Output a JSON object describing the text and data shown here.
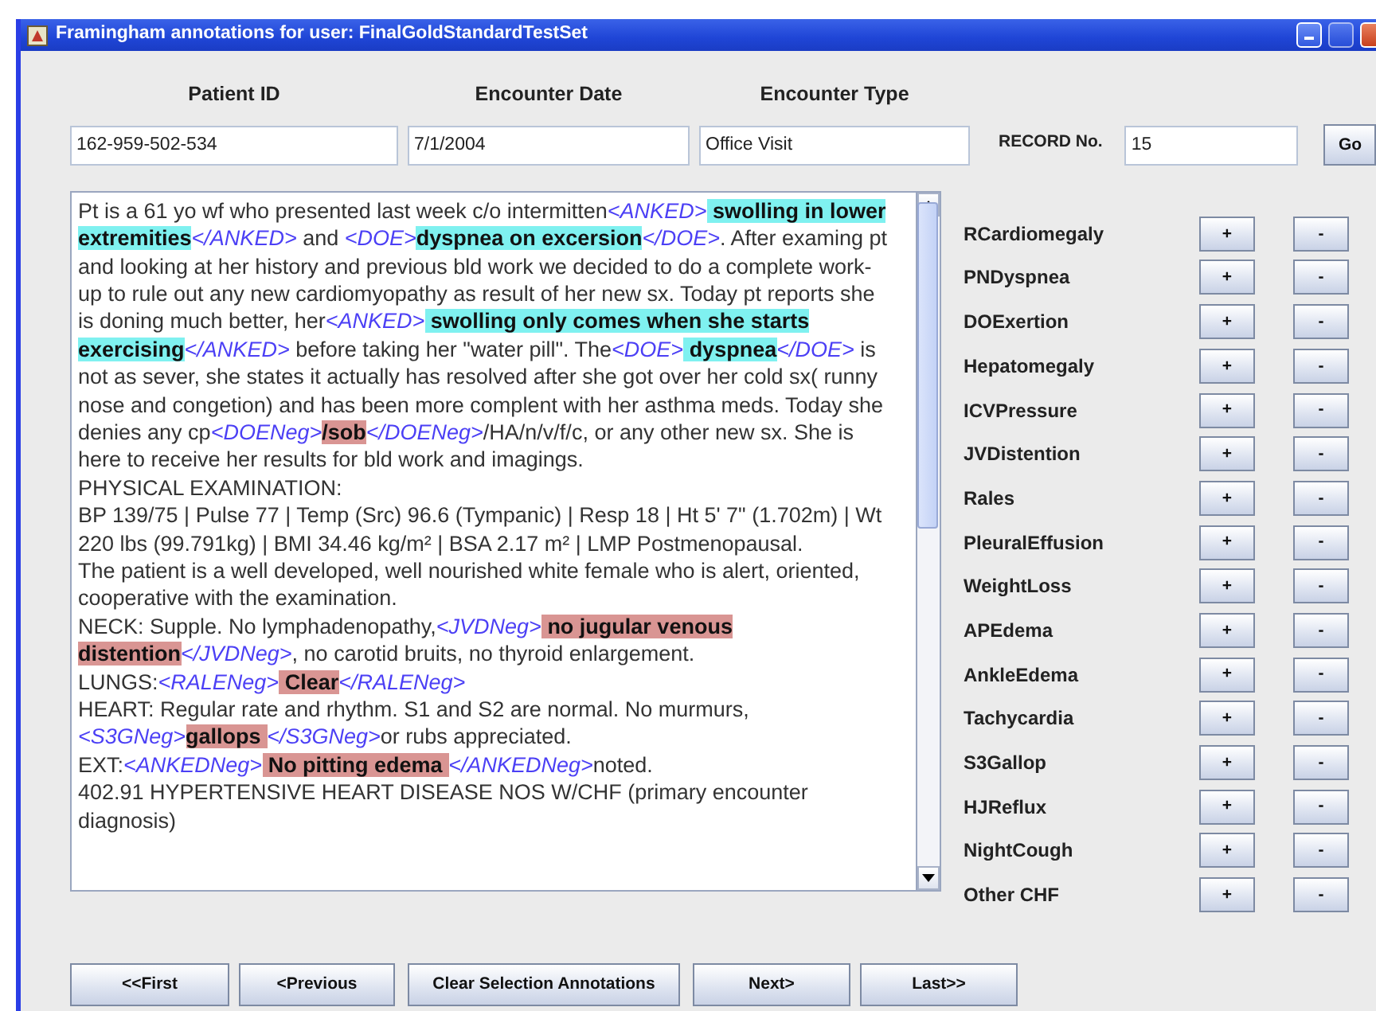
{
  "window": {
    "title": "Framingham annotations for user: FinalGoldStandardTestSet"
  },
  "header": {
    "fields": [
      {
        "label": "Patient ID",
        "value": "162-959-502-534"
      },
      {
        "label": "Encounter Date",
        "value": "7/1/2004"
      },
      {
        "label": "Encounter Type",
        "value": "Office Visit"
      }
    ],
    "record": {
      "label": "RECORD No.",
      "value": "15"
    },
    "go_button": "Go"
  },
  "note": {
    "paragraphs": [
      [
        {
          "kind": "text",
          "text": "Pt is a 61 yo wf who presented last week c/o intermitten"
        },
        {
          "kind": "tag",
          "text": "<ANKED>"
        },
        {
          "kind": "pos",
          "text": " swolling in lower extremities"
        },
        {
          "kind": "tag",
          "text": "</ANKED>"
        },
        {
          "kind": "text",
          "text": " and "
        },
        {
          "kind": "tag",
          "text": "<DOE>"
        },
        {
          "kind": "pos",
          "text": "dyspnea on excersion"
        },
        {
          "kind": "tag",
          "text": "</DOE>"
        },
        {
          "kind": "text",
          "text": ".  After examing pt and looking at her history and previous bld work we decided to do a complete work-up to rule out any new cardiomyopathy as result of her new sx.  Today pt reports she is doning much better, her"
        },
        {
          "kind": "tag",
          "text": "<ANKED>"
        },
        {
          "kind": "pos",
          "text": " swolling only comes when she starts exercising"
        },
        {
          "kind": "tag",
          "text": "</ANKED>"
        },
        {
          "kind": "text",
          "text": " before taking her \"water pill\".  The"
        },
        {
          "kind": "tag",
          "text": "<DOE>"
        },
        {
          "kind": "pos",
          "text": " dyspnea"
        },
        {
          "kind": "tag",
          "text": "</DOE>"
        },
        {
          "kind": "text",
          "text": " is not as sever, she states it actually has resolved after she got over her cold sx( runny nose and congetion)  and has been more complent with her asthma meds.  Today she denies any cp"
        },
        {
          "kind": "tag",
          "text": "<DOENeg>"
        },
        {
          "kind": "neg",
          "text": "/sob"
        },
        {
          "kind": "tag",
          "text": "</DOENeg>"
        },
        {
          "kind": "text",
          "text": "/HA/n/v/f/c, or any other new sx. She is here to receive her results for bld work and imagings."
        }
      ],
      [
        {
          "kind": "text",
          "text": "PHYSICAL EXAMINATION:"
        }
      ],
      [
        {
          "kind": "text",
          "text": "BP 139/75 | Pulse 77 | Temp (Src) 96.6 (Tympanic) | Resp 18 | Ht 5' 7\" (1.702m) | Wt 220 lbs (99.791kg) | BMI 34.46 kg/m² | BSA 2.17 m² | LMP Postmenopausal."
        }
      ],
      [
        {
          "kind": "text",
          "text": "The patient is a well developed, well nourished white female who is alert, oriented, cooperative with the examination."
        }
      ],
      [
        {
          "kind": "text",
          "text": "NECK: Supple. No lymphadenopathy,"
        },
        {
          "kind": "tag",
          "text": "<JVDNeg>"
        },
        {
          "kind": "neg",
          "text": " no jugular venous distention"
        },
        {
          "kind": "tag",
          "text": "</JVDNeg>"
        },
        {
          "kind": "text",
          "text": ", no carotid bruits, no thyroid enlargement."
        }
      ],
      [
        {
          "kind": "text",
          "text": "LUNGS:"
        },
        {
          "kind": "tag",
          "text": "<RALENeg>"
        },
        {
          "kind": "neg",
          "text": " Clear"
        },
        {
          "kind": "tag",
          "text": "</RALENeg>"
        }
      ],
      [
        {
          "kind": "text",
          "text": "HEART: Regular rate and rhythm. S1 and S2 are normal. No murmurs,"
        }
      ],
      [
        {
          "kind": "tag",
          "text": "<S3GNeg>"
        },
        {
          "kind": "neg",
          "text": "gallops "
        },
        {
          "kind": "tag",
          "text": "</S3GNeg>"
        },
        {
          "kind": "text",
          "text": "or rubs appreciated."
        }
      ],
      [
        {
          "kind": "text",
          "text": "EXT:"
        },
        {
          "kind": "tag",
          "text": "<ANKEDNeg>"
        },
        {
          "kind": "neg",
          "text": " No pitting edema "
        },
        {
          "kind": "tag",
          "text": "</ANKEDNeg>"
        },
        {
          "kind": "text",
          "text": "noted."
        }
      ],
      [
        {
          "kind": "text",
          "text": "402.91 HYPERTENSIVE HEART DISEASE NOS W/CHF  (primary encounter diagnosis)"
        }
      ]
    ]
  },
  "annotations": [
    {
      "label": "RCardiomegaly",
      "plus": "+",
      "minus": "-"
    },
    {
      "label": "PNDyspnea",
      "plus": "+",
      "minus": "-"
    },
    {
      "label": "DOExertion",
      "plus": "+",
      "minus": "-"
    },
    {
      "label": "Hepatomegaly",
      "plus": "+",
      "minus": "-"
    },
    {
      "label": "ICVPressure",
      "plus": "+",
      "minus": "-"
    },
    {
      "label": "JVDistention",
      "plus": "+",
      "minus": "-"
    },
    {
      "label": "Rales",
      "plus": "+",
      "minus": "-"
    },
    {
      "label": "PleuralEffusion",
      "plus": "+",
      "minus": "-"
    },
    {
      "label": "WeightLoss",
      "plus": "+",
      "minus": "-"
    },
    {
      "label": "APEdema",
      "plus": "+",
      "minus": "-"
    },
    {
      "label": "AnkleEdema",
      "plus": "+",
      "minus": "-"
    },
    {
      "label": "Tachycardia",
      "plus": "+",
      "minus": "-"
    },
    {
      "label": "S3Gallop",
      "plus": "+",
      "minus": "-"
    },
    {
      "label": "HJReflux",
      "plus": "+",
      "minus": "-"
    },
    {
      "label": "NightCough",
      "plus": "+",
      "minus": "-"
    },
    {
      "label": "Other CHF",
      "plus": "+",
      "minus": "-"
    }
  ],
  "nav_buttons": [
    "<<First",
    "<Previous",
    "Clear Selection Annotations",
    "Next>",
    "Last>>"
  ]
}
